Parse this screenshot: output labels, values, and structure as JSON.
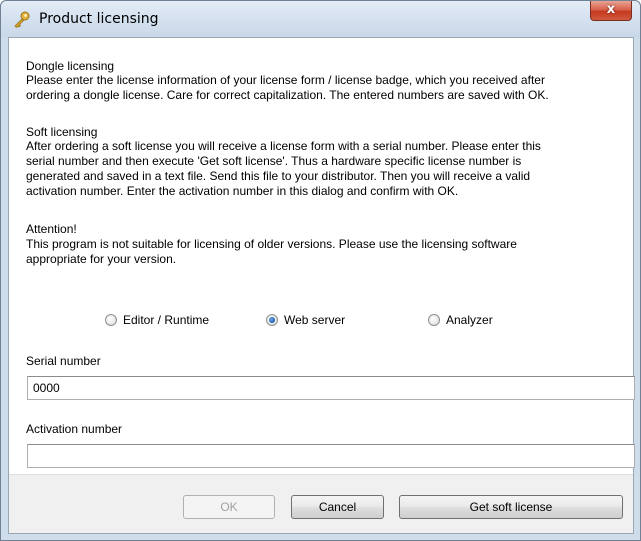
{
  "window": {
    "title": "Product licensing",
    "close_label": "x"
  },
  "dongle": {
    "heading": "Dongle licensing",
    "text": "Please enter the license information of your license form / license badge, which you received after\nordering a dongle license. Care for correct capitalization. The entered numbers are saved with OK."
  },
  "soft": {
    "heading": "Soft licensing",
    "text": "After ordering a soft license you will receive a license form with a serial number. Please enter this\nserial number and then execute 'Get soft license'. Thus a hardware specific license number is\ngenerated and saved in a text file. Send this file to your distributor. Then you will receive a valid\nactivation number. Enter the activation number in this dialog and confirm with OK."
  },
  "attention": {
    "heading": "Attention!",
    "text": "This program is not suitable for licensing of older versions. Please use the licensing software\nappropriate for your version."
  },
  "options": {
    "items": [
      {
        "label": "Editor / Runtime",
        "checked": false
      },
      {
        "label": "Web server",
        "checked": true
      },
      {
        "label": "Analyzer",
        "checked": false
      }
    ]
  },
  "serial": {
    "label": "Serial number",
    "value": "0000"
  },
  "activation": {
    "label": "Activation number",
    "value": ""
  },
  "buttons": {
    "ok": "OK",
    "cancel": "Cancel",
    "get_soft_license": "Get soft license"
  }
}
